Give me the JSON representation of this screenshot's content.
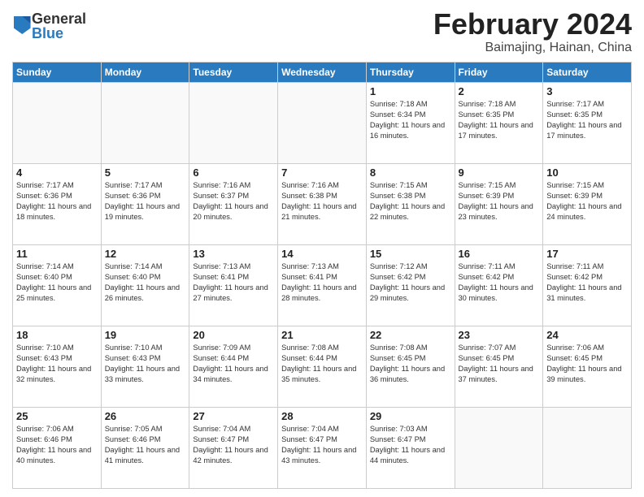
{
  "header": {
    "logo_general": "General",
    "logo_blue": "Blue",
    "title": "February 2024",
    "location": "Baimajing, Hainan, China"
  },
  "days_of_week": [
    "Sunday",
    "Monday",
    "Tuesday",
    "Wednesday",
    "Thursday",
    "Friday",
    "Saturday"
  ],
  "weeks": [
    [
      {
        "day": "",
        "info": ""
      },
      {
        "day": "",
        "info": ""
      },
      {
        "day": "",
        "info": ""
      },
      {
        "day": "",
        "info": ""
      },
      {
        "day": "1",
        "info": "Sunrise: 7:18 AM\nSunset: 6:34 PM\nDaylight: 11 hours and 16 minutes."
      },
      {
        "day": "2",
        "info": "Sunrise: 7:18 AM\nSunset: 6:35 PM\nDaylight: 11 hours and 17 minutes."
      },
      {
        "day": "3",
        "info": "Sunrise: 7:17 AM\nSunset: 6:35 PM\nDaylight: 11 hours and 17 minutes."
      }
    ],
    [
      {
        "day": "4",
        "info": "Sunrise: 7:17 AM\nSunset: 6:36 PM\nDaylight: 11 hours and 18 minutes."
      },
      {
        "day": "5",
        "info": "Sunrise: 7:17 AM\nSunset: 6:36 PM\nDaylight: 11 hours and 19 minutes."
      },
      {
        "day": "6",
        "info": "Sunrise: 7:16 AM\nSunset: 6:37 PM\nDaylight: 11 hours and 20 minutes."
      },
      {
        "day": "7",
        "info": "Sunrise: 7:16 AM\nSunset: 6:38 PM\nDaylight: 11 hours and 21 minutes."
      },
      {
        "day": "8",
        "info": "Sunrise: 7:15 AM\nSunset: 6:38 PM\nDaylight: 11 hours and 22 minutes."
      },
      {
        "day": "9",
        "info": "Sunrise: 7:15 AM\nSunset: 6:39 PM\nDaylight: 11 hours and 23 minutes."
      },
      {
        "day": "10",
        "info": "Sunrise: 7:15 AM\nSunset: 6:39 PM\nDaylight: 11 hours and 24 minutes."
      }
    ],
    [
      {
        "day": "11",
        "info": "Sunrise: 7:14 AM\nSunset: 6:40 PM\nDaylight: 11 hours and 25 minutes."
      },
      {
        "day": "12",
        "info": "Sunrise: 7:14 AM\nSunset: 6:40 PM\nDaylight: 11 hours and 26 minutes."
      },
      {
        "day": "13",
        "info": "Sunrise: 7:13 AM\nSunset: 6:41 PM\nDaylight: 11 hours and 27 minutes."
      },
      {
        "day": "14",
        "info": "Sunrise: 7:13 AM\nSunset: 6:41 PM\nDaylight: 11 hours and 28 minutes."
      },
      {
        "day": "15",
        "info": "Sunrise: 7:12 AM\nSunset: 6:42 PM\nDaylight: 11 hours and 29 minutes."
      },
      {
        "day": "16",
        "info": "Sunrise: 7:11 AM\nSunset: 6:42 PM\nDaylight: 11 hours and 30 minutes."
      },
      {
        "day": "17",
        "info": "Sunrise: 7:11 AM\nSunset: 6:42 PM\nDaylight: 11 hours and 31 minutes."
      }
    ],
    [
      {
        "day": "18",
        "info": "Sunrise: 7:10 AM\nSunset: 6:43 PM\nDaylight: 11 hours and 32 minutes."
      },
      {
        "day": "19",
        "info": "Sunrise: 7:10 AM\nSunset: 6:43 PM\nDaylight: 11 hours and 33 minutes."
      },
      {
        "day": "20",
        "info": "Sunrise: 7:09 AM\nSunset: 6:44 PM\nDaylight: 11 hours and 34 minutes."
      },
      {
        "day": "21",
        "info": "Sunrise: 7:08 AM\nSunset: 6:44 PM\nDaylight: 11 hours and 35 minutes."
      },
      {
        "day": "22",
        "info": "Sunrise: 7:08 AM\nSunset: 6:45 PM\nDaylight: 11 hours and 36 minutes."
      },
      {
        "day": "23",
        "info": "Sunrise: 7:07 AM\nSunset: 6:45 PM\nDaylight: 11 hours and 37 minutes."
      },
      {
        "day": "24",
        "info": "Sunrise: 7:06 AM\nSunset: 6:45 PM\nDaylight: 11 hours and 39 minutes."
      }
    ],
    [
      {
        "day": "25",
        "info": "Sunrise: 7:06 AM\nSunset: 6:46 PM\nDaylight: 11 hours and 40 minutes."
      },
      {
        "day": "26",
        "info": "Sunrise: 7:05 AM\nSunset: 6:46 PM\nDaylight: 11 hours and 41 minutes."
      },
      {
        "day": "27",
        "info": "Sunrise: 7:04 AM\nSunset: 6:47 PM\nDaylight: 11 hours and 42 minutes."
      },
      {
        "day": "28",
        "info": "Sunrise: 7:04 AM\nSunset: 6:47 PM\nDaylight: 11 hours and 43 minutes."
      },
      {
        "day": "29",
        "info": "Sunrise: 7:03 AM\nSunset: 6:47 PM\nDaylight: 11 hours and 44 minutes."
      },
      {
        "day": "",
        "info": ""
      },
      {
        "day": "",
        "info": ""
      }
    ]
  ]
}
